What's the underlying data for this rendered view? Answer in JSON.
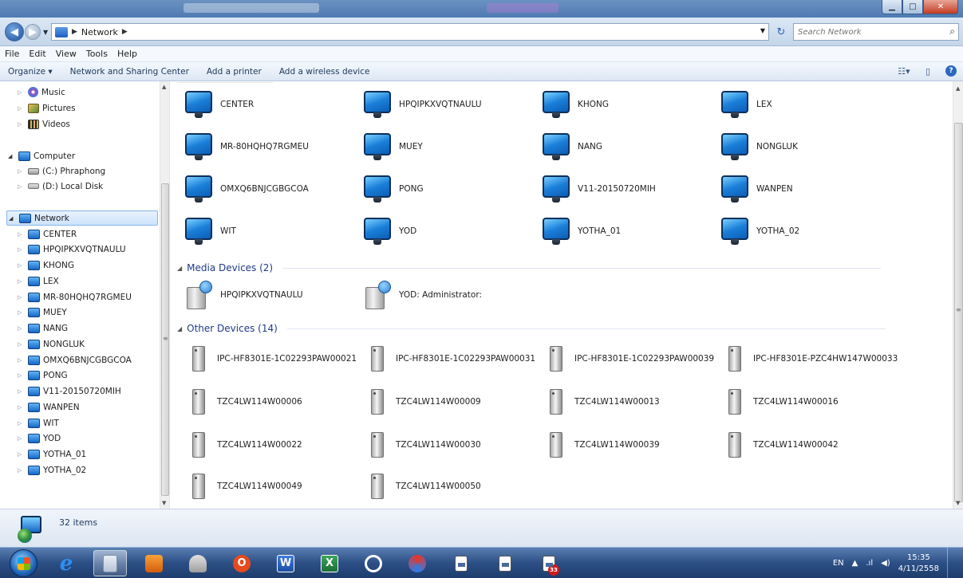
{
  "address": {
    "crumbs": [
      "Network"
    ],
    "search_placeholder": "Search Network"
  },
  "menu": [
    "File",
    "Edit",
    "View",
    "Tools",
    "Help"
  ],
  "commandbar": {
    "organize": "Organize ▾",
    "network_sharing": "Network and Sharing Center",
    "add_printer": "Add a printer",
    "add_wireless": "Add a wireless device"
  },
  "nav_tree": {
    "libraries": [
      "Music",
      "Pictures",
      "Videos"
    ],
    "computer": "Computer",
    "drives": [
      "(C:) Phraphong",
      "(D:) Local Disk"
    ],
    "network": "Network",
    "network_children": [
      "CENTER",
      "HPQIPKXVQTNAULU",
      "KHONG",
      "LEX",
      "MR-80HQHQ7RGMEU",
      "MUEY",
      "NANG",
      "NONGLUK",
      "OMXQ6BNJCGBGCOA",
      "PONG",
      "V11-20150720MIH",
      "WANPEN",
      "WIT",
      "YOD",
      "YOTHA_01",
      "YOTHA_02"
    ]
  },
  "computers": [
    "CENTER",
    "HPQIPKXVQTNAULU",
    "KHONG",
    "LEX",
    "MR-80HQHQ7RGMEU",
    "MUEY",
    "NANG",
    "NONGLUK",
    "OMXQ6BNJCGBGCOA",
    "PONG",
    "V11-20150720MIH",
    "WANPEN",
    "WIT",
    "YOD",
    "YOTHA_01",
    "YOTHA_02"
  ],
  "media_group": {
    "title": "Media Devices (2)",
    "items": [
      "HPQIPKXVQTNAULU",
      "YOD: Administrator:"
    ]
  },
  "other_group": {
    "title": "Other Devices (14)",
    "items": [
      "IPC-HF8301E-1C02293PAW00021",
      "IPC-HF8301E-1C02293PAW00031",
      "IPC-HF8301E-1C02293PAW00039",
      "IPC-HF8301E-PZC4HW147W00033",
      "TZC4LW114W00006",
      "TZC4LW114W00009",
      "TZC4LW114W00013",
      "TZC4LW114W00016",
      "TZC4LW114W00022",
      "TZC4LW114W00030",
      "TZC4LW114W00039",
      "TZC4LW114W00042",
      "TZC4LW114W00049",
      "TZC4LW114W00050"
    ]
  },
  "status": {
    "count": "32 items"
  },
  "taskbar": {
    "apps": [
      "internet-explorer-icon",
      "windows-explorer-icon",
      "media-player-icon",
      "tool-icon",
      "office-icon",
      "word-icon",
      "excel-icon",
      "circle-app-icon",
      "swirl-app-icon",
      "document-icon",
      "document-icon",
      "document-icon"
    ],
    "badge": "33",
    "lang": "EN",
    "time": "15:35",
    "date": "4/11/2558"
  }
}
